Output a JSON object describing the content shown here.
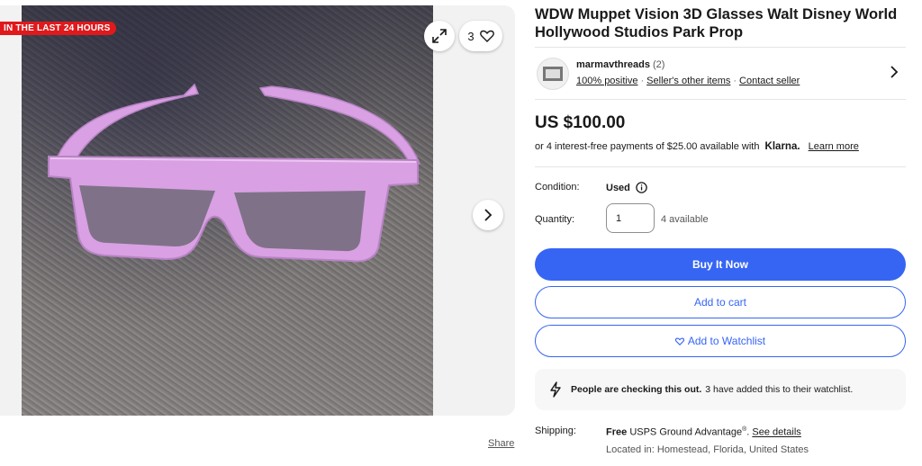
{
  "gallery": {
    "badge": "IN THE LAST 24 HOURS",
    "watch_count": "3",
    "share_label": "Share"
  },
  "listing": {
    "title": "WDW Muppet Vision 3D Glasses Walt Disney World Hollywood Studios Park Prop"
  },
  "seller": {
    "name": "marmavthreads",
    "feedback_count": "(2)",
    "positive": "100% positive",
    "other_items": "Seller's other items",
    "contact": "Contact seller"
  },
  "pricing": {
    "price": "US $100.00",
    "installments_text": "or 4 interest-free payments of $25.00 available with",
    "klarna": "Klarna.",
    "learn_more": "Learn more"
  },
  "details": {
    "condition_label": "Condition:",
    "condition_value": "Used",
    "quantity_label": "Quantity:",
    "quantity_value": "1",
    "available": "4 available"
  },
  "actions": {
    "buy_now": "Buy It Now",
    "add_to_cart": "Add to cart",
    "add_to_watchlist": "Add to Watchlist"
  },
  "signal": {
    "bold": "People are checking this out.",
    "text": "3 have added this to their watchlist."
  },
  "shipping": {
    "label": "Shipping:",
    "free": "Free",
    "service": "USPS Ground Advantage",
    "reg": "®",
    "see_details": "See details",
    "located": "Located in: Homestead, Florida, United States"
  },
  "colors": {
    "accent": "#3665f3",
    "badge": "#e0191c",
    "glasses": "#d9a0e3"
  }
}
